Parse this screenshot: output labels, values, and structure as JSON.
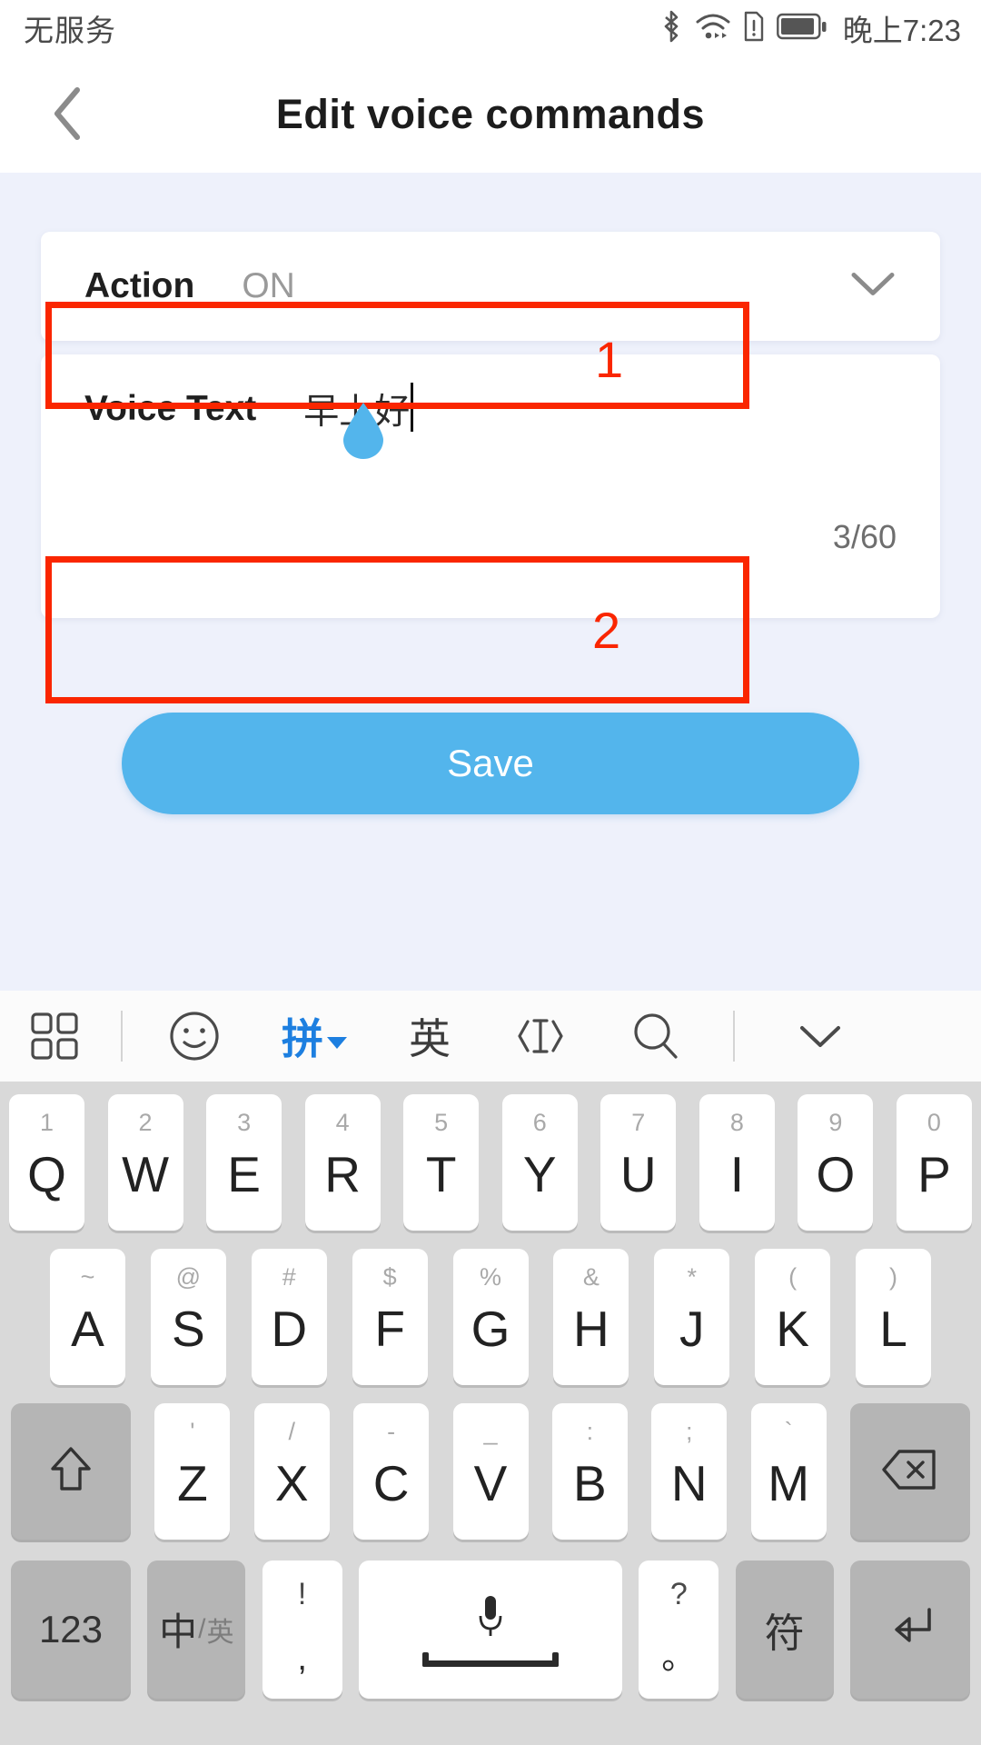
{
  "status_bar": {
    "carrier": "无服务",
    "clock": "晚上7:23",
    "icons": [
      "bluetooth-icon",
      "wifi-icon",
      "sim-warning-icon",
      "battery-icon"
    ]
  },
  "header": {
    "title": "Edit voice commands",
    "back_icon": "chevron-left-icon"
  },
  "form": {
    "action_row": {
      "label": "Action",
      "value": "ON",
      "chevron_icon": "chevron-down-icon"
    },
    "voice_row": {
      "label": "Voice Text",
      "value": "早上好",
      "counter": "3/60"
    }
  },
  "save": {
    "label": "Save",
    "color": "#53b5ec"
  },
  "annotations": {
    "color": "#fa2600",
    "marks": [
      {
        "number": "1",
        "target": "voice-text-field"
      },
      {
        "number": "2",
        "target": "save-button"
      }
    ]
  },
  "keyboard": {
    "toolbar": [
      {
        "name": "keyboard-grid-icon",
        "glyph": "",
        "type": "icon"
      },
      {
        "name": "toolbar-divider",
        "glyph": "",
        "type": "divider"
      },
      {
        "name": "emoji-icon",
        "glyph": "",
        "type": "icon"
      },
      {
        "name": "pinyin-mode-button",
        "glyph": "拼",
        "type": "text",
        "active": true
      },
      {
        "name": "english-mode-button",
        "glyph": "英",
        "type": "text",
        "active": false
      },
      {
        "name": "cursor-move-icon",
        "glyph": "",
        "type": "icon"
      },
      {
        "name": "search-icon",
        "glyph": "",
        "type": "icon"
      },
      {
        "name": "toolbar-divider-2",
        "glyph": "",
        "type": "divider"
      },
      {
        "name": "hide-keyboard-icon",
        "glyph": "",
        "type": "icon"
      }
    ],
    "row1": [
      {
        "main": "Q",
        "sup": "1"
      },
      {
        "main": "W",
        "sup": "2"
      },
      {
        "main": "E",
        "sup": "3"
      },
      {
        "main": "R",
        "sup": "4"
      },
      {
        "main": "T",
        "sup": "5"
      },
      {
        "main": "Y",
        "sup": "6"
      },
      {
        "main": "U",
        "sup": "7"
      },
      {
        "main": "I",
        "sup": "8"
      },
      {
        "main": "O",
        "sup": "9"
      },
      {
        "main": "P",
        "sup": "0"
      }
    ],
    "row2": [
      {
        "main": "A",
        "sup": "~"
      },
      {
        "main": "S",
        "sup": "@"
      },
      {
        "main": "D",
        "sup": "#"
      },
      {
        "main": "F",
        "sup": "$"
      },
      {
        "main": "G",
        "sup": "%"
      },
      {
        "main": "H",
        "sup": "&"
      },
      {
        "main": "J",
        "sup": "*"
      },
      {
        "main": "K",
        "sup": "("
      },
      {
        "main": "L",
        "sup": ")"
      }
    ],
    "row3": {
      "shift": "shift-icon",
      "keys": [
        {
          "main": "Z",
          "sup": "'"
        },
        {
          "main": "X",
          "sup": "/"
        },
        {
          "main": "C",
          "sup": "-"
        },
        {
          "main": "V",
          "sup": "_"
        },
        {
          "main": "B",
          "sup": ":"
        },
        {
          "main": "N",
          "sup": ";"
        },
        {
          "main": "M",
          "sup": "`"
        }
      ],
      "backspace": "backspace-icon"
    },
    "row4": {
      "numbers": "123",
      "lang_cn": "中",
      "lang_sep": "/",
      "lang_en": "英",
      "comma_top": "!",
      "comma_bot": ",",
      "space_icon": "microphone-icon",
      "period_top": "?",
      "period_bot": "。",
      "symbols": "符",
      "enter": "enter-icon"
    }
  }
}
